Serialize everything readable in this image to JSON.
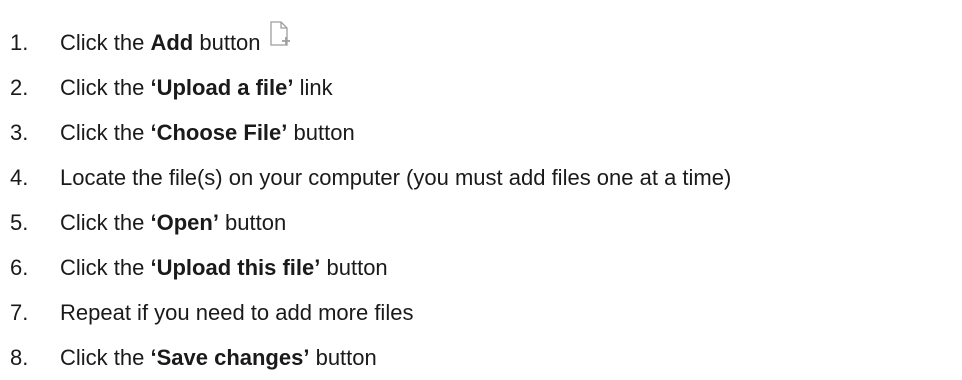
{
  "steps": [
    {
      "number": "1.",
      "pre": "Click the ",
      "bold": "Add",
      "post": " button",
      "icon": "add-file-icon"
    },
    {
      "number": "2.",
      "pre": "Click the ",
      "bold": "‘Upload a file’",
      "post": " link"
    },
    {
      "number": "3.",
      "pre": "Click the ",
      "bold": "‘Choose File’",
      "post": " button"
    },
    {
      "number": "4.",
      "pre": "Locate the file(s) on your computer (you must add files one at a time)",
      "bold": "",
      "post": ""
    },
    {
      "number": "5.",
      "pre": "Click the ",
      "bold": "‘Open’",
      "post": " button"
    },
    {
      "number": "6.",
      "pre": "Click the ",
      "bold": "‘Upload this file’",
      "post": " button"
    },
    {
      "number": "7.",
      "pre": "Repeat if you need to add more files",
      "bold": "",
      "post": ""
    },
    {
      "number": "8.",
      "pre": "Click the ",
      "bold": "‘Save changes’",
      "post": " button"
    }
  ],
  "colors": {
    "text": "#1a1a1a",
    "icon_outline": "#9e9e9e"
  }
}
